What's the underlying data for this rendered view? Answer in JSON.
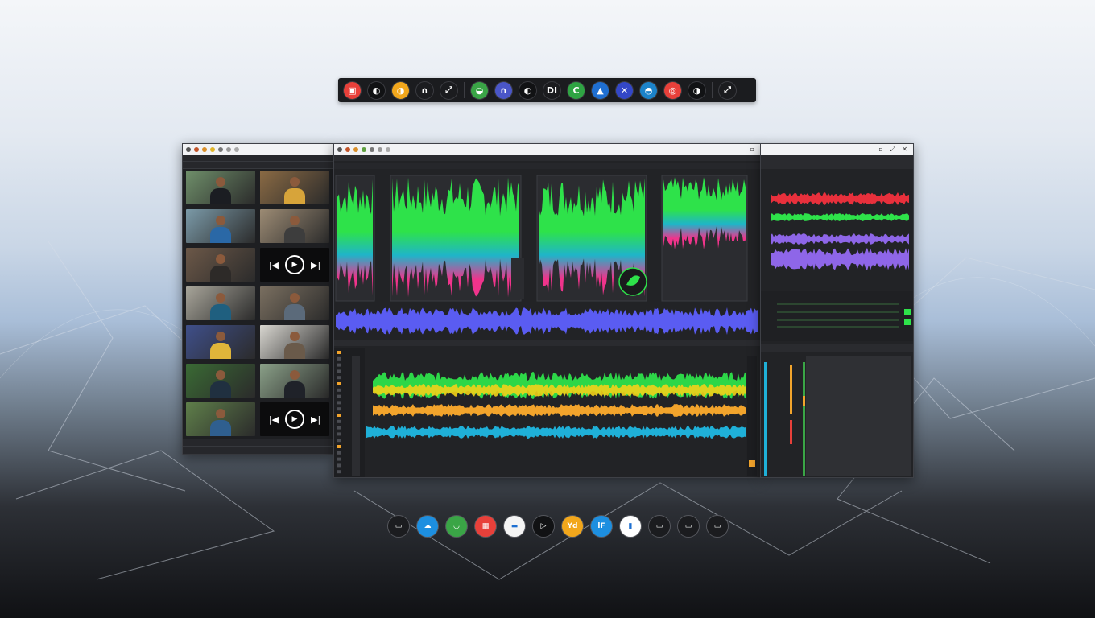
{
  "top_dock": {
    "icons": [
      {
        "name": "app-red-icon",
        "glyph": "▣",
        "color": "#e8403a"
      },
      {
        "name": "app-dark-icon",
        "glyph": "◐",
        "color": "#111214"
      },
      {
        "name": "app-yellow-icon",
        "glyph": "◑",
        "color": "#f2a71c"
      },
      {
        "name": "app-outline-icon",
        "glyph": "∩",
        "color": "#1b1c1f"
      },
      {
        "name": "link-icon",
        "glyph": "⤢",
        "color": "#1b1c1f"
      },
      {
        "name": "app-green-icon",
        "glyph": "◒",
        "color": "#3aa546"
      },
      {
        "name": "app-blue-icon",
        "glyph": "∩",
        "color": "#4a56c8"
      },
      {
        "name": "app-half-icon",
        "glyph": "◐",
        "color": "#111214"
      },
      {
        "name": "app-di-icon",
        "glyph": "DI",
        "color": "#1b1c1f"
      },
      {
        "name": "app-green-c-icon",
        "glyph": "C",
        "color": "#2fa443"
      },
      {
        "name": "app-drop-icon",
        "glyph": "▲",
        "color": "#1f6fd1"
      },
      {
        "name": "app-cross-icon",
        "glyph": "✕",
        "color": "#3347c7"
      },
      {
        "name": "app-teal-icon",
        "glyph": "◓",
        "color": "#1c83c9"
      },
      {
        "name": "app-red-ring-icon",
        "glyph": "◎",
        "color": "#e8403a"
      },
      {
        "name": "app-moon-icon",
        "glyph": "◑",
        "color": "#111214"
      },
      {
        "name": "link-chain-icon",
        "glyph": "⤢",
        "color": "#1b1c1f"
      }
    ]
  },
  "bottom_dock": {
    "icons": [
      {
        "name": "dock-dark-icon",
        "glyph": "▭",
        "color": "#1b1c1f"
      },
      {
        "name": "dock-blue-icon",
        "glyph": "☁",
        "color": "#1d8fe0"
      },
      {
        "name": "dock-green-icon",
        "glyph": "◡",
        "color": "#3aa546"
      },
      {
        "name": "dock-red-icon",
        "glyph": "▦",
        "color": "#e8403a"
      },
      {
        "name": "dock-white-icon",
        "glyph": "▬",
        "color": "#f4f4f4"
      },
      {
        "name": "dock-play-icon",
        "glyph": "▷",
        "color": "#111214"
      },
      {
        "name": "dock-orange-icon",
        "glyph": "Yd",
        "color": "#f2a71c"
      },
      {
        "name": "dock-blue-2-icon",
        "glyph": "lF",
        "color": "#1d8fe0"
      },
      {
        "name": "dock-bottle-icon",
        "glyph": "▮",
        "color": "#ffffff"
      },
      {
        "name": "dock-dark-2-icon",
        "glyph": "▭",
        "color": "#1b1c1f"
      },
      {
        "name": "dock-dark-3-icon",
        "glyph": "▭",
        "color": "#1b1c1f"
      },
      {
        "name": "dock-dark-4-icon",
        "glyph": "▭",
        "color": "#1b1c1f"
      }
    ]
  },
  "media_browser": {
    "thumbnails": [
      {
        "bg": "#6f8f6a",
        "shirt": "#1b1d22"
      },
      {
        "bg": "#8a6a44",
        "shirt": "#d7a43a"
      },
      {
        "bg": "#7b9aa8",
        "shirt": "#2a68a6"
      },
      {
        "bg": "#9c8b74",
        "shirt": "#3d3d3d"
      },
      {
        "bg": "#6c5848",
        "shirt": "#2d2a28"
      },
      {
        "bg": "#a8a59a",
        "shirt": "#1f5f7f"
      },
      {
        "bg": "#7a6f60",
        "shirt": "#5b6a7a"
      },
      {
        "bg": "#3f4f8a",
        "shirt": "#e0b53a"
      },
      {
        "bg": "#d8d6d0",
        "shirt": "#6a5a4a"
      },
      {
        "bg": "#3a6a34",
        "shirt": "#203040"
      },
      {
        "bg": "#8aa088",
        "shirt": "#1f2229"
      },
      {
        "bg": "#5f7f4a",
        "shirt": "#2f5f8f"
      }
    ],
    "player_play": "▶",
    "player_prev": "|◀",
    "player_next": "▶|"
  },
  "colors": {
    "green": "#2ee24a",
    "cyan": "#1fb5c8",
    "pink": "#f0348c",
    "blue": "#5a5cf2",
    "red": "#e8303c",
    "purple": "#8e66e8",
    "yellow": "#f2d21a",
    "orange": "#f2a42c",
    "teal": "#1fb0d8"
  }
}
